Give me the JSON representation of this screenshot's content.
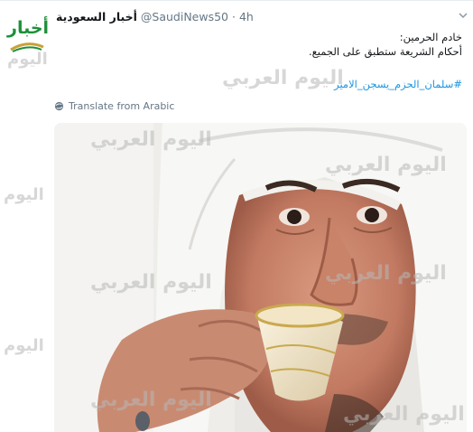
{
  "tweet": {
    "display_name": "أخبار السعودية",
    "handle": "@SaudiNews50",
    "separator": "·",
    "time": "4h",
    "text_lines": [
      "خادم الحرمين:",
      "أحكام الشريعة ستطبق على الجميع."
    ],
    "hashtag": "#سلمان_الحزم_يسجن_الامير",
    "translate_label": "Translate from Arabic"
  },
  "avatar": {
    "text": "أخبار",
    "brand_color": "#1e8f3a"
  },
  "watermark": {
    "text": "اليوم العربي",
    "short": "اليوم"
  },
  "colors": {
    "link": "#1b95e0",
    "muted": "#657786",
    "text": "#14171a",
    "border": "#e6ecf0"
  }
}
